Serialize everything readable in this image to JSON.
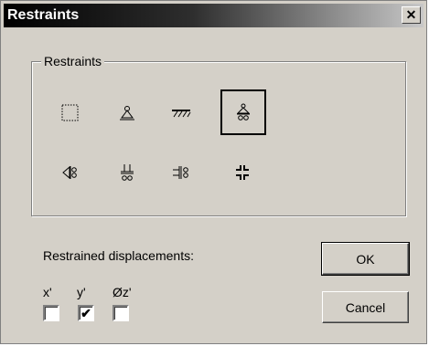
{
  "window": {
    "title": "Restraints",
    "close_label": "x"
  },
  "group": {
    "label": "Restraints"
  },
  "restraint_types": [
    {
      "icon": "empty-restraint-icon",
      "selected": false
    },
    {
      "icon": "pin-support-icon",
      "selected": false
    },
    {
      "icon": "fixed-wall-icon",
      "selected": false
    },
    {
      "icon": "roller-support-icon",
      "selected": true
    },
    {
      "icon": "roller-left-icon",
      "selected": false
    },
    {
      "icon": "roller-bottom-icon",
      "selected": false
    },
    {
      "icon": "roller-right-icon",
      "selected": false
    },
    {
      "icon": "clamp-icon",
      "selected": false
    }
  ],
  "displacements": {
    "label": "Restrained displacements:",
    "items": [
      {
        "label": "x'",
        "checked": false
      },
      {
        "label": "y'",
        "checked": true
      },
      {
        "label": "Øz'",
        "checked": false
      }
    ]
  },
  "buttons": {
    "ok": "OK",
    "cancel": "Cancel"
  }
}
